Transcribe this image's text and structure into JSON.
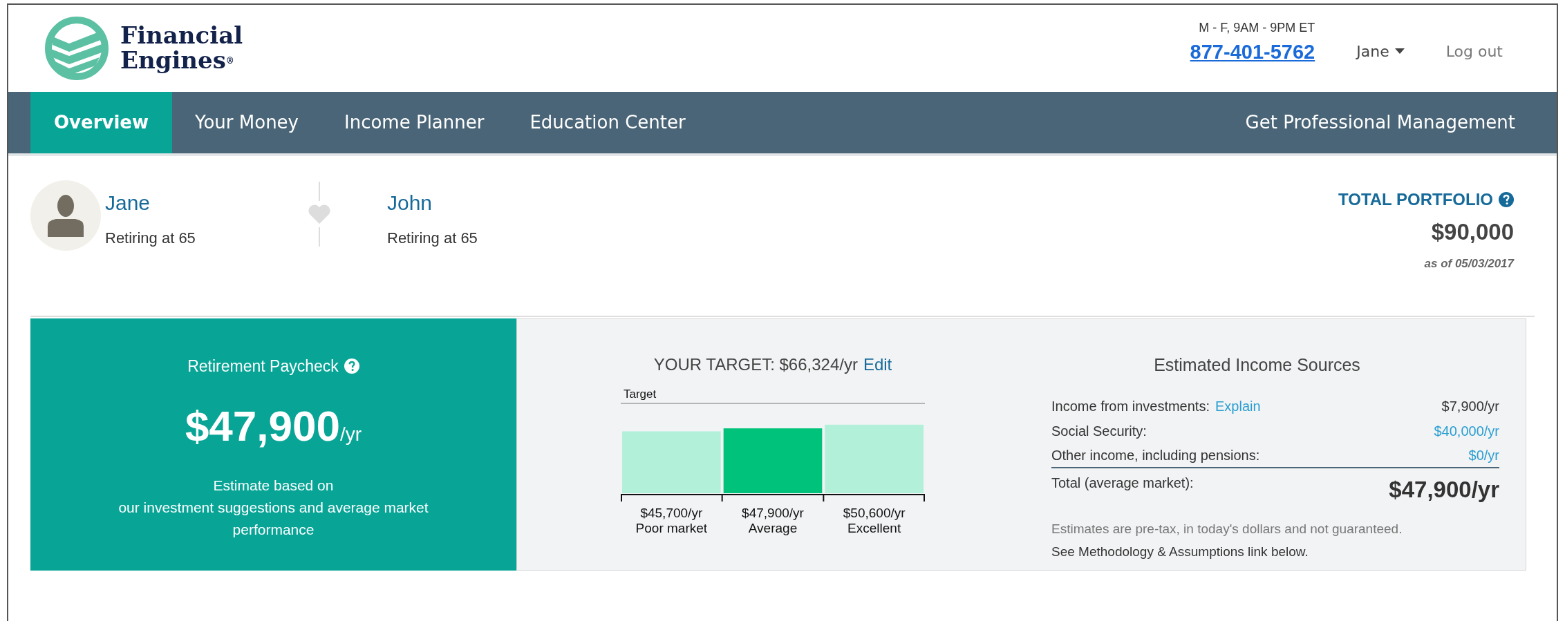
{
  "header": {
    "logo": {
      "line1": "Financial",
      "line2": "Engines",
      "mark": "®"
    },
    "hours": "M - F, 9AM - 9PM ET",
    "phone": "877-401-5762",
    "user_menu": "Jane",
    "logout": "Log out"
  },
  "nav": {
    "tabs": [
      {
        "label": "Overview",
        "selected": true
      },
      {
        "label": "Your Money",
        "selected": false
      },
      {
        "label": "Income Planner",
        "selected": false
      },
      {
        "label": "Education Center",
        "selected": false
      }
    ],
    "cta": "Get Professional Management"
  },
  "people": [
    {
      "name": "Jane",
      "subtitle": "Retiring at 65",
      "avatar": true
    },
    {
      "name": "John",
      "subtitle": "Retiring at 65",
      "avatar": false
    }
  ],
  "portfolio": {
    "label": "TOTAL PORTFOLIO",
    "value": "$90,000",
    "as_of": "as of 05/03/2017"
  },
  "paycheck": {
    "title": "Retirement Paycheck",
    "amount": "$47,900",
    "unit": "/yr",
    "description": [
      "Estimate based on",
      "our investment suggestions and average market performance"
    ]
  },
  "target": {
    "label": "YOUR TARGET: $66,324/yr",
    "edit": "Edit",
    "chart_data": {
      "type": "bar",
      "categories": [
        "Poor market",
        "Average",
        "Excellent"
      ],
      "values": [
        45700,
        47900,
        50600
      ],
      "ylim": [
        0,
        66324
      ],
      "value_labels": [
        "$45,700/yr",
        "$47,900/yr",
        "$50,600/yr"
      ],
      "colors": [
        "#b3f0da",
        "#00c27a",
        "#b3f0da"
      ],
      "annotations": [
        "Target"
      ]
    }
  },
  "income": {
    "title": "Estimated Income Sources",
    "rows": [
      {
        "label": "Income from investments:",
        "link": "Explain",
        "value": "$7,900/yr",
        "value_link": false
      },
      {
        "label": "Social Security:",
        "value": "$40,000/yr",
        "value_link": true
      },
      {
        "label": "Other income, including pensions:",
        "value": "$0/yr",
        "value_link": true
      }
    ],
    "total": {
      "label": "Total (average market):",
      "value": "$47,900/yr"
    },
    "notes": [
      "Estimates are pre-tax, in today's dollars and not guaranteed.",
      "See Methodology & Assumptions link below."
    ]
  }
}
